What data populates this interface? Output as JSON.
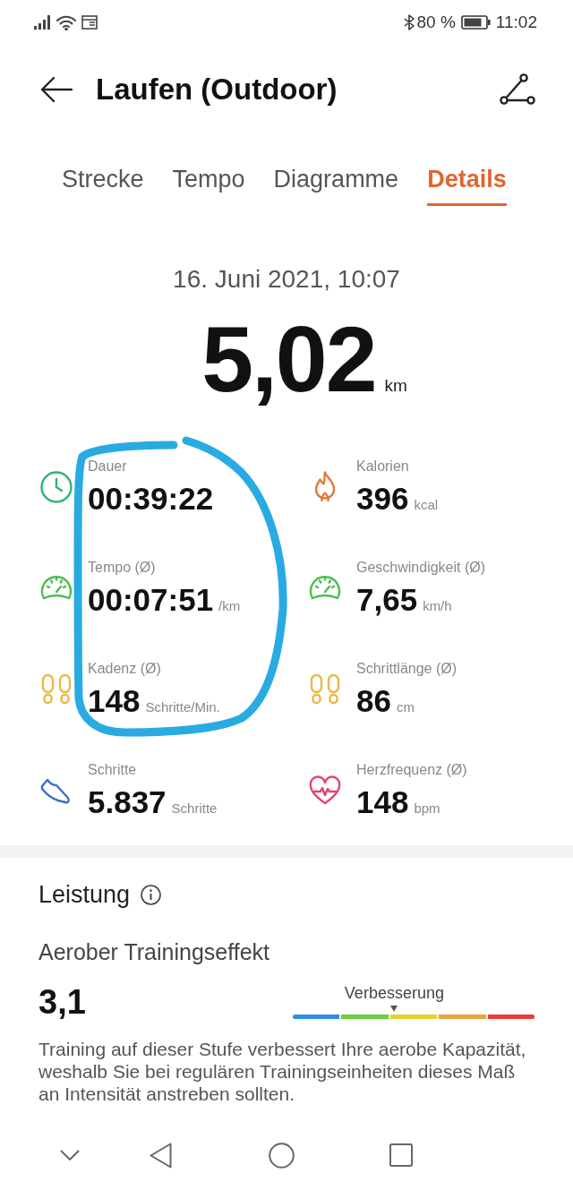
{
  "status_bar": {
    "battery": "80 %",
    "time": "11:02"
  },
  "header": {
    "title": "Laufen (Outdoor)"
  },
  "tabs": [
    {
      "label": "Strecke",
      "selected": false
    },
    {
      "label": "Tempo",
      "selected": false
    },
    {
      "label": "Diagramme",
      "selected": false
    },
    {
      "label": "Details",
      "selected": true
    }
  ],
  "summary": {
    "date": "16. Juni 2021, 10:07",
    "distance": "5,02",
    "unit": "km"
  },
  "stats": [
    {
      "kind": "clock",
      "color": "#2bb673",
      "label": "Dauer",
      "value": "00:39:22"
    },
    {
      "kind": "flame",
      "color": "#e07a3c",
      "label": "Kalorien",
      "value": "396",
      "unit": "kcal"
    },
    {
      "kind": "speedometer",
      "color": "#4cbf4f",
      "label": "Tempo (Ø)",
      "value": "00:07:51",
      "unit": "/km"
    },
    {
      "kind": "speedometer",
      "color": "#4cbf4f",
      "label": "Geschwindigkeit (Ø)",
      "value": "7,65",
      "unit": "km/h"
    },
    {
      "kind": "footprints",
      "color": "#e9b949",
      "label": "Kadenz (Ø)",
      "value": "148",
      "unit": "Schritte/Min."
    },
    {
      "kind": "footprints",
      "color": "#e9b949",
      "label": "Schrittlänge (Ø)",
      "value": "86",
      "unit": "cm"
    },
    {
      "kind": "shoe",
      "color": "#3a6fc4",
      "label": "Schritte",
      "value": "5.837",
      "unit": "Schritte"
    },
    {
      "kind": "heart",
      "color": "#e2456c",
      "label": "Herzfrequenz (Ø)",
      "value": "148",
      "unit": "bpm"
    }
  ],
  "performance": {
    "title": "Leistung",
    "metric": "Aerober Trainingseffekt",
    "value": "3,1",
    "scale": {
      "label": "Verbesserung",
      "level": 0.42,
      "segments": [
        {
          "color": "#2d8ee6"
        },
        {
          "color": "#6ccf3f"
        },
        {
          "color": "#e3d233"
        },
        {
          "color": "#eda43a"
        },
        {
          "color": "#ec3b32"
        }
      ]
    },
    "description": "Training auf dieser Stufe verbessert Ihre aerobe Kapazität, weshalb Sie bei regulären Trainingseinheiten dieses Maß an Intensität anstreben sollten."
  }
}
